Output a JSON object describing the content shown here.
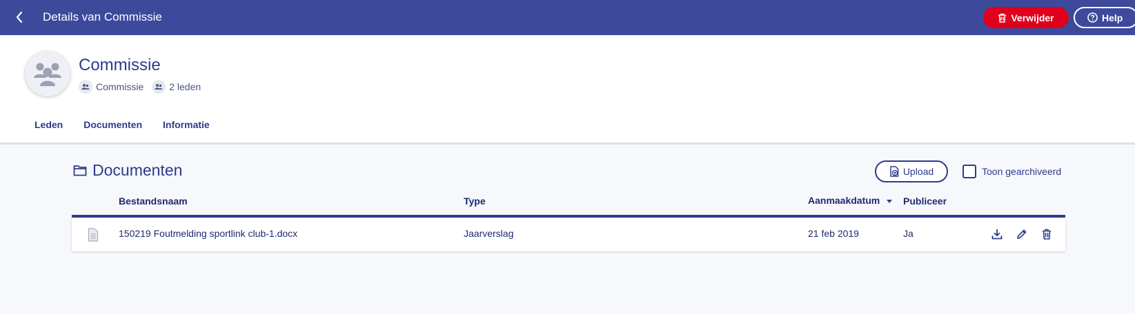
{
  "topbar": {
    "title": "Details van Commissie",
    "delete_label": "Verwijder",
    "help_label": "Help"
  },
  "entity": {
    "name": "Commissie",
    "type": "Commissie",
    "members": "2 leden"
  },
  "tabs": [
    {
      "label": "Leden",
      "active": false
    },
    {
      "label": "Documenten",
      "active": true
    },
    {
      "label": "Informatie",
      "active": false
    }
  ],
  "documents": {
    "title": "Documenten",
    "upload_label": "Upload",
    "show_archived_label": "Toon gearchiveerd",
    "show_archived_checked": false,
    "columns": {
      "name": "Bestandsnaam",
      "type": "Type",
      "date": "Aanmaakdatum",
      "publish": "Publiceer"
    },
    "rows": [
      {
        "name": "150219 Foutmelding sportlink club-1.docx",
        "type": "Jaarverslag",
        "date": "21 feb 2019",
        "publish": "Ja"
      }
    ]
  },
  "colors": {
    "primary": "#3d4a9c",
    "text": "#2d3a8c",
    "danger": "#e0001b"
  }
}
